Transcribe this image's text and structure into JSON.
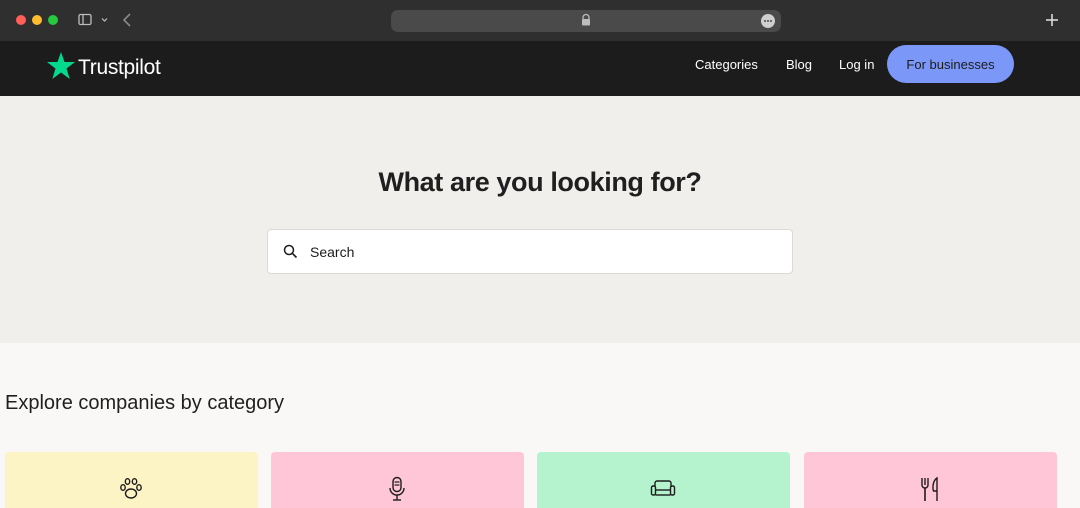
{
  "browser": {
    "icons": [
      "sidebar-toggle-icon",
      "chevron-down-icon",
      "back-chevron-icon",
      "lock-icon",
      "more-options-icon",
      "plus-icon"
    ]
  },
  "header": {
    "logo_text": "Trustpilot",
    "logo_color": "#04da8d",
    "nav": {
      "categories": "Categories",
      "blog": "Blog",
      "login": "Log in",
      "for_businesses": "For businesses"
    },
    "cta_color": "#7b98f8"
  },
  "hero": {
    "title": "What are you looking for?",
    "search": {
      "placeholder": "Search",
      "value": ""
    }
  },
  "explore": {
    "title": "Explore companies by category",
    "categories": [
      {
        "icon": "paw-icon",
        "color": "#fdf4c5"
      },
      {
        "icon": "microphone-icon",
        "color": "#ffc6d8"
      },
      {
        "icon": "sofa-icon",
        "color": "#b4f3cd"
      },
      {
        "icon": "fork-knife-icon",
        "color": "#ffc6d8"
      }
    ]
  }
}
